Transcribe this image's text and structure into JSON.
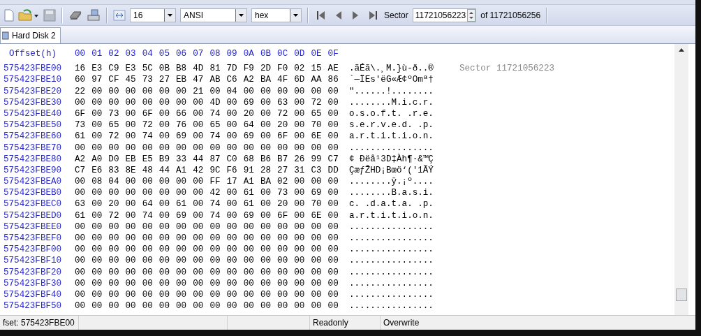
{
  "toolbar": {
    "bytes_per_row": "16",
    "charset": "ANSI",
    "mode": "hex",
    "sector_label": "Sector",
    "sector": "11721056223",
    "sector_total": "of 11721056256"
  },
  "tabs": [
    {
      "label": "Hard Disk 2",
      "selected": true
    }
  ],
  "editor": {
    "offset_header": "Offset(h)",
    "columns": [
      "00",
      "01",
      "02",
      "03",
      "04",
      "05",
      "06",
      "07",
      "08",
      "09",
      "0A",
      "0B",
      "0C",
      "0D",
      "0E",
      "0F"
    ],
    "side_note": "Sector 11721056223",
    "rows": [
      {
        "offset": "575423FBE00",
        "hex": "16 E3 C9 E3 5C 0B B8 4D 81 7D F9 2D F0 02 15 AE",
        "text": ".ãÉã\\.¸M.}ù-ð..®"
      },
      {
        "offset": "575423FBE10",
        "hex": "60 97 CF 45 73 27 EB 47 AB C6 A2 BA 4F 6D AA 86",
        "text": "`—ÏEs'ëG«Æ¢ºOmª†"
      },
      {
        "offset": "575423FBE20",
        "hex": "22 00 00 00 00 00 00 21 00 04 00 00 00 00 00 00",
        "text": "\"......!........"
      },
      {
        "offset": "575423FBE30",
        "hex": "00 00 00 00 00 00 00 00 4D 00 69 00 63 00 72 00",
        "text": "........M.i.c.r."
      },
      {
        "offset": "575423FBE40",
        "hex": "6F 00 73 00 6F 00 66 00 74 00 20 00 72 00 65 00",
        "text": "o.s.o.f.t. .r.e."
      },
      {
        "offset": "575423FBE50",
        "hex": "73 00 65 00 72 00 76 00 65 00 64 00 20 00 70 00",
        "text": "s.e.r.v.e.d. .p."
      },
      {
        "offset": "575423FBE60",
        "hex": "61 00 72 00 74 00 69 00 74 00 69 00 6F 00 6E 00",
        "text": "a.r.t.i.t.i.o.n."
      },
      {
        "offset": "575423FBE70",
        "hex": "00 00 00 00 00 00 00 00 00 00 00 00 00 00 00 00",
        "text": "................"
      },
      {
        "offset": "575423FBE80",
        "hex": "A2 A0 D0 EB E5 B9 33 44 87 C0 68 B6 B7 26 99 C7",
        "text": "¢ Ðëå¹3D‡Àh¶·&™Ç"
      },
      {
        "offset": "575423FBE90",
        "hex": "C7 E6 83 8E 48 44 A1 42 9C F6 91 28 27 31 C3 DD",
        "text": "ÇæƒŽHD¡Bœö‘('1ÃÝ"
      },
      {
        "offset": "575423FBEA0",
        "hex": "00 08 04 00 00 00 00 00 FF 17 A1 BA 02 00 00 00",
        "text": "........ÿ.¡º...."
      },
      {
        "offset": "575423FBEB0",
        "hex": "00 00 00 00 00 00 00 00 42 00 61 00 73 00 69 00",
        "text": "........B.a.s.i."
      },
      {
        "offset": "575423FBEC0",
        "hex": "63 00 20 00 64 00 61 00 74 00 61 00 20 00 70 00",
        "text": "c. .d.a.t.a. .p."
      },
      {
        "offset": "575423FBED0",
        "hex": "61 00 72 00 74 00 69 00 74 00 69 00 6F 00 6E 00",
        "text": "a.r.t.i.t.i.o.n."
      },
      {
        "offset": "575423FBEE0",
        "hex": "00 00 00 00 00 00 00 00 00 00 00 00 00 00 00 00",
        "text": "................"
      },
      {
        "offset": "575423FBEF0",
        "hex": "00 00 00 00 00 00 00 00 00 00 00 00 00 00 00 00",
        "text": "................"
      },
      {
        "offset": "575423FBF00",
        "hex": "00 00 00 00 00 00 00 00 00 00 00 00 00 00 00 00",
        "text": "................"
      },
      {
        "offset": "575423FBF10",
        "hex": "00 00 00 00 00 00 00 00 00 00 00 00 00 00 00 00",
        "text": "................"
      },
      {
        "offset": "575423FBF20",
        "hex": "00 00 00 00 00 00 00 00 00 00 00 00 00 00 00 00",
        "text": "................"
      },
      {
        "offset": "575423FBF30",
        "hex": "00 00 00 00 00 00 00 00 00 00 00 00 00 00 00 00",
        "text": "................"
      },
      {
        "offset": "575423FBF40",
        "hex": "00 00 00 00 00 00 00 00 00 00 00 00 00 00 00 00",
        "text": "................"
      },
      {
        "offset": "575423FBF50",
        "hex": "00 00 00 00 00 00 00 00 00 00 00 00 00 00 00 00",
        "text": "................"
      }
    ]
  },
  "status_bar": {
    "offset": "fset: 575423FBE00",
    "access": "Readonly",
    "mode": "Overwrite"
  }
}
